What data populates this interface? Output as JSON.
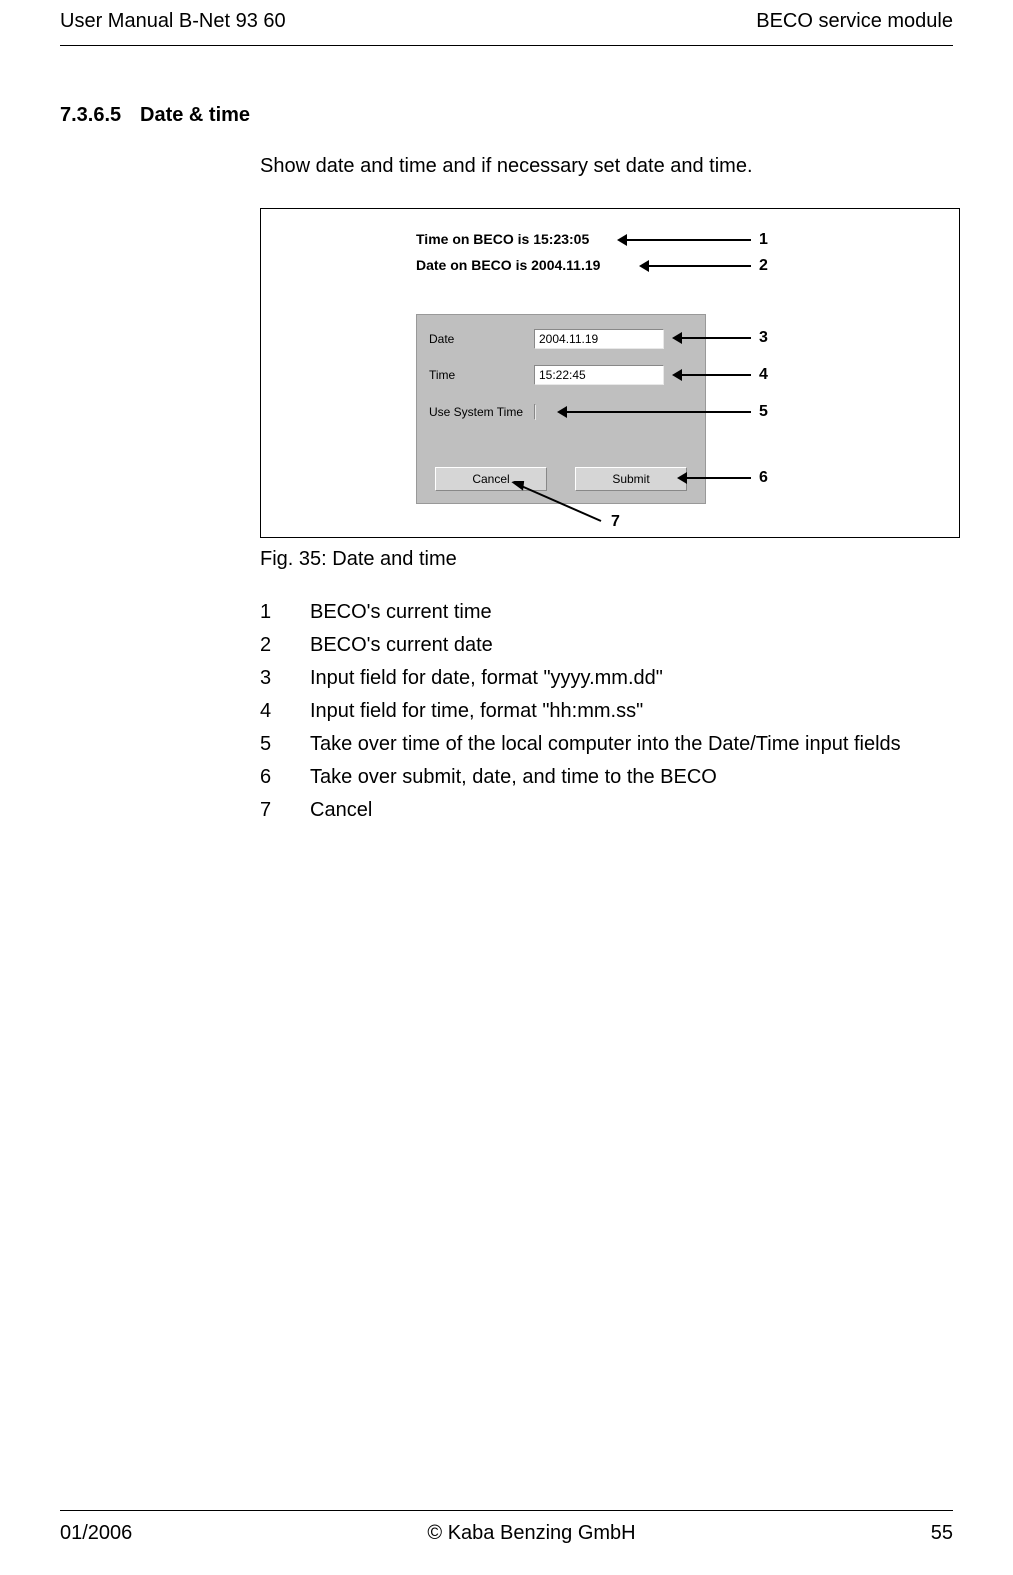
{
  "header": {
    "left": "User Manual B-Net 93 60",
    "right": "BECO service module"
  },
  "section": {
    "number": "7.3.6.5",
    "title": "Date & time"
  },
  "intro": "Show date and time and if necessary set date and time.",
  "figure": {
    "time_text": "Time on BECO is 15:23:05",
    "date_text": "Date on BECO is 2004.11.19",
    "panel": {
      "date_label": "Date",
      "date_value": "2004.11.19",
      "time_label": "Time",
      "time_value": "15:22:45",
      "syscheck_label": "Use System Time",
      "cancel": "Cancel",
      "submit": "Submit"
    },
    "callouts": {
      "c1": "1",
      "c2": "2",
      "c3": "3",
      "c4": "4",
      "c5": "5",
      "c6": "6",
      "c7": "7"
    },
    "caption": "Fig. 35: Date and time"
  },
  "legend": [
    {
      "num": "1",
      "text": "BECO's current time"
    },
    {
      "num": "2",
      "text": "BECO's current date"
    },
    {
      "num": "3",
      "text": "Input field for date, format \"yyyy.mm.dd\""
    },
    {
      "num": "4",
      "text": "Input field for time, format \"hh:mm.ss\""
    },
    {
      "num": "5",
      "text": "Take over time of the local computer into the Date/Time input fields"
    },
    {
      "num": "6",
      "text": "Take over submit, date, and time to the BECO"
    },
    {
      "num": "7",
      "text": "Cancel"
    }
  ],
  "footer": {
    "left": "01/2006",
    "center": "© Kaba Benzing GmbH",
    "right": "55"
  }
}
